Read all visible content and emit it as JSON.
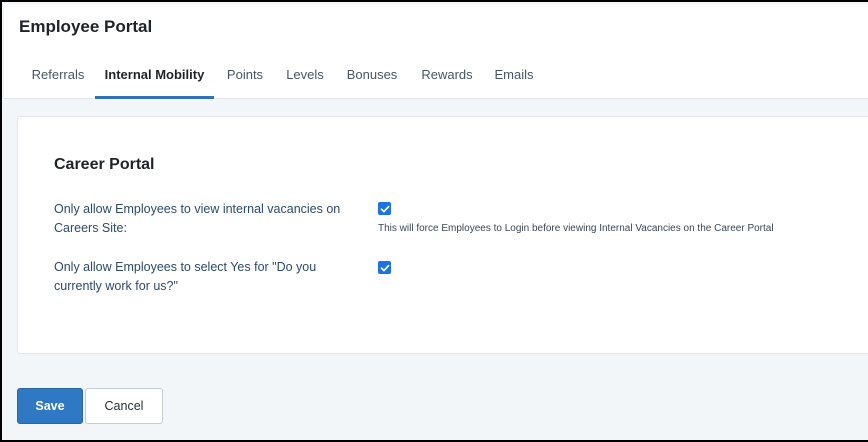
{
  "header": {
    "title": "Employee Portal",
    "tabs": [
      {
        "label": "Referrals",
        "active": false
      },
      {
        "label": "Internal Mobility",
        "active": true
      },
      {
        "label": "Points",
        "active": false
      },
      {
        "label": "Levels",
        "active": false
      },
      {
        "label": "Bonuses",
        "active": false
      },
      {
        "label": "Rewards",
        "active": false
      },
      {
        "label": "Emails",
        "active": false
      }
    ]
  },
  "card": {
    "title": "Career Portal",
    "settings": [
      {
        "label": "Only allow Employees to view internal vacancies on Careers Site:",
        "checked": true,
        "help": "This will force Employees to Login before viewing Internal Vacancies on the Career Portal"
      },
      {
        "label": "Only allow Employees to select Yes for \"Do you currently work for us?\"",
        "checked": true,
        "help": ""
      }
    ]
  },
  "actions": {
    "save_label": "Save",
    "cancel_label": "Cancel"
  },
  "colors": {
    "accent": "#2f72b8",
    "checkbox": "#1a73e8",
    "label_text": "#2c4a6e",
    "page_bg": "#f3f6f9"
  }
}
